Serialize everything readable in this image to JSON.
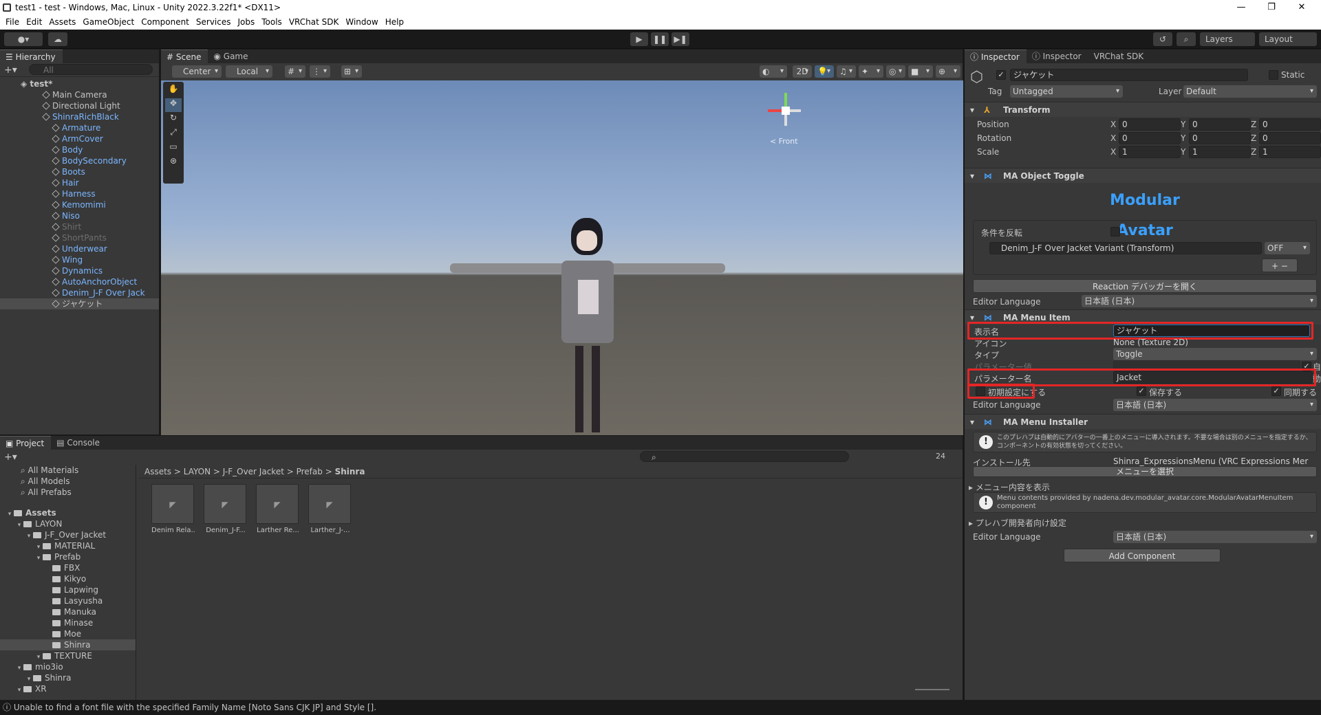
{
  "window": {
    "title": "test1 - test - Windows, Mac, Linux - Unity 2022.3.22f1* <DX11>",
    "minimize": "—",
    "maximize": "❐",
    "close": "✕"
  },
  "menu": [
    "File",
    "Edit",
    "Assets",
    "GameObject",
    "Component",
    "Services",
    "Jobs",
    "Tools",
    "VRChat SDK",
    "Window",
    "Help"
  ],
  "toolbar": {
    "layers": "Layers",
    "layout": "Layout"
  },
  "hierarchy": {
    "tab": "Hierarchy",
    "search_placeholder": "All",
    "scene_name": "test*",
    "items": [
      {
        "label": "Main Camera",
        "depth": 1,
        "style": "normal"
      },
      {
        "label": "Directional Light",
        "depth": 1,
        "style": "normal"
      },
      {
        "label": "ShinraRichBlack",
        "depth": 1,
        "style": "blue"
      },
      {
        "label": "Armature",
        "depth": 2,
        "style": "blue"
      },
      {
        "label": "ArmCover",
        "depth": 2,
        "style": "blue"
      },
      {
        "label": "Body",
        "depth": 2,
        "style": "blue"
      },
      {
        "label": "BodySecondary",
        "depth": 2,
        "style": "blue"
      },
      {
        "label": "Boots",
        "depth": 2,
        "style": "blue"
      },
      {
        "label": "Hair",
        "depth": 2,
        "style": "blue"
      },
      {
        "label": "Harness",
        "depth": 2,
        "style": "blue"
      },
      {
        "label": "Kemomimi",
        "depth": 2,
        "style": "blue"
      },
      {
        "label": "Niso",
        "depth": 2,
        "style": "blue"
      },
      {
        "label": "Shirt",
        "depth": 2,
        "style": "dim"
      },
      {
        "label": "ShortPants",
        "depth": 2,
        "style": "dim"
      },
      {
        "label": "Underwear",
        "depth": 2,
        "style": "blue"
      },
      {
        "label": "Wing",
        "depth": 2,
        "style": "blue"
      },
      {
        "label": "Dynamics",
        "depth": 2,
        "style": "blue"
      },
      {
        "label": "AutoAnchorObject",
        "depth": 2,
        "style": "blue"
      },
      {
        "label": "Denim_J-F Over Jack",
        "depth": 2,
        "style": "blue"
      },
      {
        "label": "ジャケット",
        "depth": 2,
        "style": "selected"
      }
    ]
  },
  "scene_view": {
    "tabs": [
      "Scene",
      "Game"
    ],
    "pivot": "Center",
    "space": "Local",
    "mode_2d": "2D",
    "gizmo_front": "< Front"
  },
  "project": {
    "tabs": [
      "Project",
      "Console"
    ],
    "favorites": [
      "All Materials",
      "All Models",
      "All Prefabs"
    ],
    "breadcrumb": [
      "Assets",
      "LAYON",
      "J-F_Over Jacket",
      "Prefab",
      "Shinra"
    ],
    "tree": [
      {
        "label": "Assets",
        "depth": 0,
        "bold": true
      },
      {
        "label": "LAYON",
        "depth": 1
      },
      {
        "label": "J-F_Over Jacket",
        "depth": 2
      },
      {
        "label": "MATERIAL",
        "depth": 3
      },
      {
        "label": "Prefab",
        "depth": 3
      },
      {
        "label": "FBX",
        "depth": 4
      },
      {
        "label": "Kikyo",
        "depth": 4
      },
      {
        "label": "Lapwing",
        "depth": 4
      },
      {
        "label": "Lasyusha",
        "depth": 4
      },
      {
        "label": "Manuka",
        "depth": 4
      },
      {
        "label": "Minase",
        "depth": 4
      },
      {
        "label": "Moe",
        "depth": 4
      },
      {
        "label": "Shinra",
        "depth": 4,
        "selected": true
      },
      {
        "label": "TEXTURE",
        "depth": 3
      },
      {
        "label": "mio3io",
        "depth": 1
      },
      {
        "label": "Shinra",
        "depth": 2
      },
      {
        "label": "XR",
        "depth": 1
      }
    ],
    "assets": [
      "Denim Rela...",
      "Denim_J-F...",
      "Larther Re...",
      "Larther_J-..."
    ],
    "hidden_count": "24"
  },
  "inspector": {
    "tabs": [
      "Inspector",
      "Inspector",
      "VRChat SDK"
    ],
    "object_name": "ジャケット",
    "static_label": "Static",
    "tag_label": "Tag",
    "tag_value": "Untagged",
    "layer_label": "Layer",
    "layer_value": "Default",
    "transform": {
      "title": "Transform",
      "rows": [
        {
          "label": "Position",
          "x": "0",
          "y": "0",
          "z": "0"
        },
        {
          "label": "Rotation",
          "x": "0",
          "y": "0",
          "z": "0"
        },
        {
          "label": "Scale",
          "x": "1",
          "y": "1",
          "z": "1"
        }
      ]
    },
    "toggle": {
      "title": "MA Object Toggle",
      "logo": "Modular Avatar",
      "invert_label": "条件を反転",
      "object": "Denim_J-F Over Jacket Variant (Transform)",
      "state": "OFF",
      "reaction_btn": "Reaction デバッガーを開く",
      "lang_label": "Editor Language",
      "lang_value": "日本語 (日本)"
    },
    "menu_item": {
      "title": "MA Menu Item",
      "display_name_label": "表示名",
      "display_name_value": "ジャケット",
      "icon_label": "アイコン",
      "icon_value": "None (Texture 2D)",
      "type_label": "タイプ",
      "type_value": "Toggle",
      "param_value_label": "パラメーター値",
      "auto_label": "自動",
      "param_name_label": "パラメーター名",
      "param_name_value": "Jacket",
      "default_label": "初期設定にする",
      "save_label": "保存する",
      "sync_label": "同期する",
      "lang_label": "Editor Language",
      "lang_value": "日本語 (日本)"
    },
    "installer": {
      "title": "MA Menu Installer",
      "notice": "このプレハブは自動的にアバターの一番上のメニューに導入されます。不要な場合は別のメニューを指定するか、コンポーネントの有効状態を切ってください。",
      "install_label": "インストール先",
      "install_value": "Shinra_ExpressionsMenu (VRC Expressions Mer",
      "select_btn": "メニューを選択",
      "show_contents": "メニュー内容を表示",
      "contents_notice": "Menu contents provided by nadena.dev.modular_avatar.core.ModularAvatarMenuItem component",
      "dev_settings": "プレハブ開発者向け設定",
      "lang_label": "Editor Language",
      "lang_value": "日本語 (日本)"
    },
    "add_component": "Add Component"
  },
  "status": {
    "message": "Unable to find a font file with the specified Family Name [Noto Sans CJK JP] and Style []."
  }
}
